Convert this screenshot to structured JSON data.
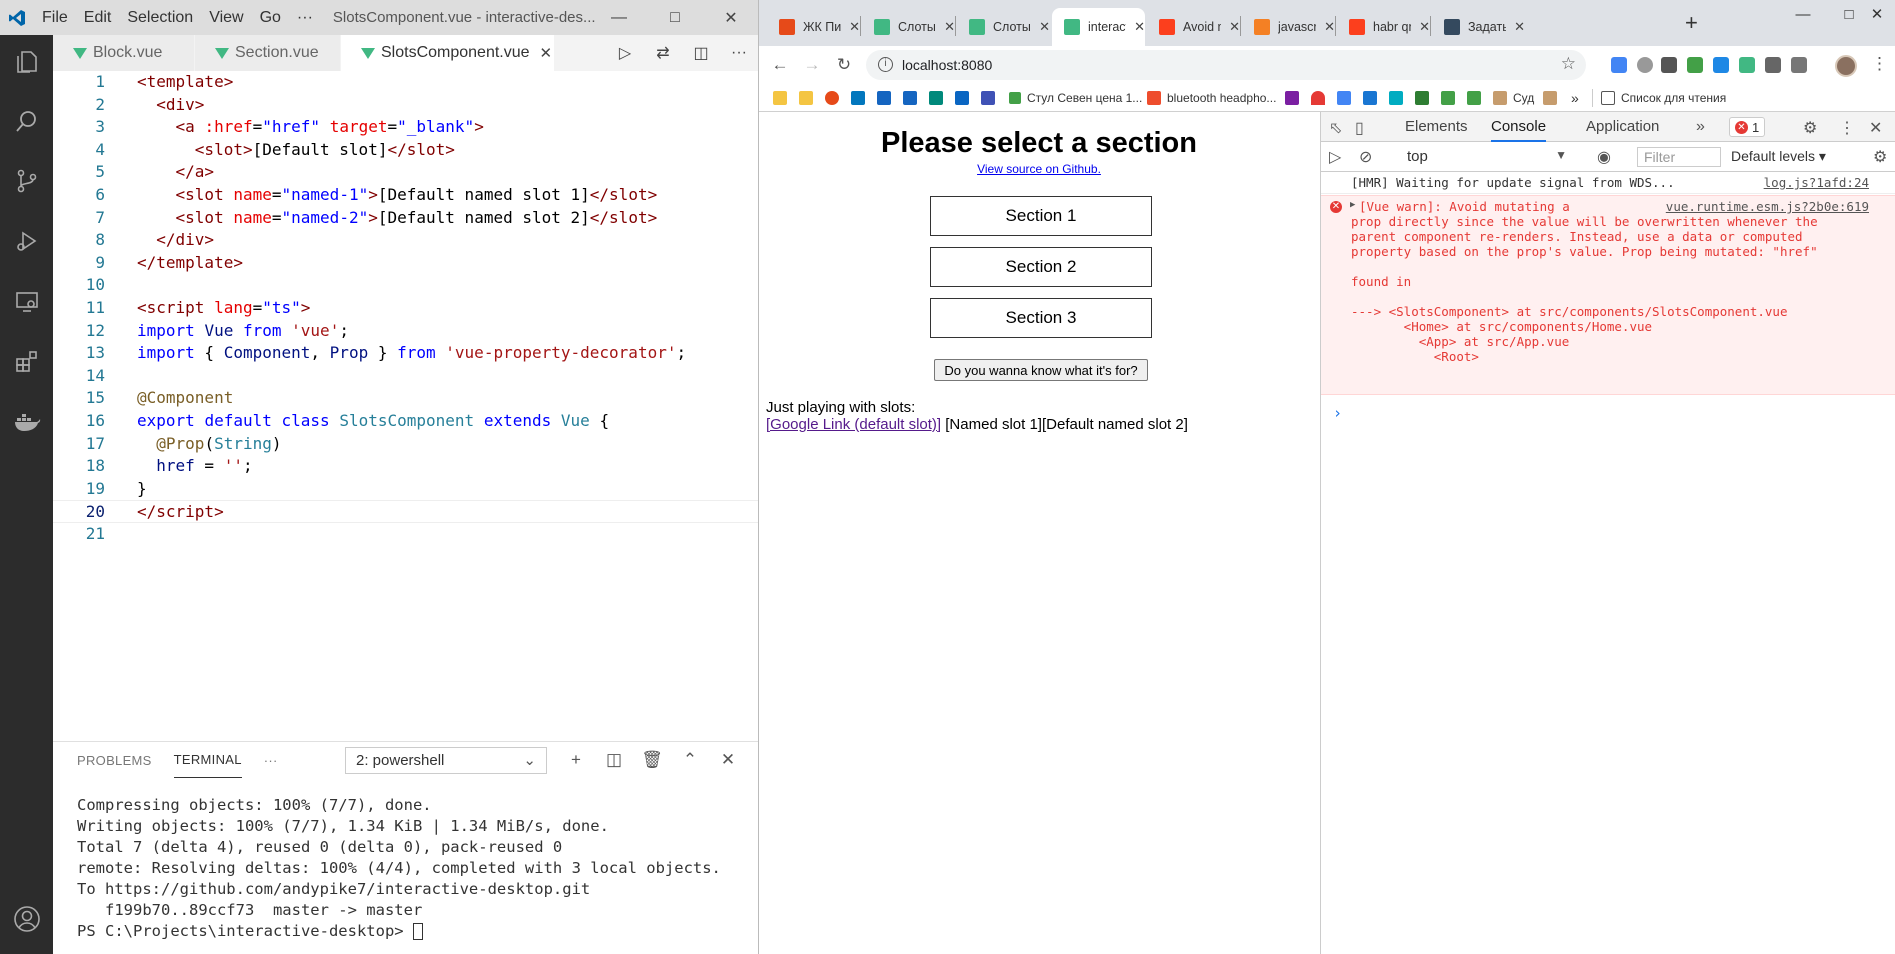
{
  "vscode": {
    "menu": [
      "File",
      "Edit",
      "Selection",
      "View",
      "Go",
      "···"
    ],
    "window_title": "SlotsComponent.vue - interactive-des...",
    "tabs": [
      {
        "label": "Block.vue"
      },
      {
        "label": "Section.vue"
      },
      {
        "label": "SlotsComponent.vue"
      }
    ],
    "code": [
      {
        "n": "1",
        "html": "<span class='t-tag'>&lt;template&gt;</span>"
      },
      {
        "n": "2",
        "html": "  <span class='t-tag'>&lt;div&gt;</span>"
      },
      {
        "n": "3",
        "html": "    <span class='t-tag'>&lt;a</span> <span class='t-attr'>:href</span>=<span class='t-str'>\"href\"</span> <span class='t-attr'>target</span>=<span class='t-str'>\"_blank\"</span><span class='t-tag'>&gt;</span>"
      },
      {
        "n": "4",
        "html": "      <span class='t-tag'>&lt;slot&gt;</span>[Default slot]<span class='t-tag'>&lt;/slot&gt;</span>"
      },
      {
        "n": "5",
        "html": "    <span class='t-tag'>&lt;/a&gt;</span>"
      },
      {
        "n": "6",
        "html": "    <span class='t-tag'>&lt;slot</span> <span class='t-attr'>name</span>=<span class='t-str'>\"named-1\"</span><span class='t-tag'>&gt;</span>[Default named slot 1]<span class='t-tag'>&lt;/slot&gt;</span>"
      },
      {
        "n": "7",
        "html": "    <span class='t-tag'>&lt;slot</span> <span class='t-attr'>name</span>=<span class='t-str'>\"named-2\"</span><span class='t-tag'>&gt;</span>[Default named slot 2]<span class='t-tag'>&lt;/slot&gt;</span>"
      },
      {
        "n": "8",
        "html": "  <span class='t-tag'>&lt;/div&gt;</span>"
      },
      {
        "n": "9",
        "html": "<span class='t-tag'>&lt;/template&gt;</span>"
      },
      {
        "n": "10",
        "html": ""
      },
      {
        "n": "11",
        "html": "<span class='t-tag'>&lt;script</span> <span class='t-attr'>lang</span>=<span class='t-str'>\"ts\"</span><span class='t-tag'>&gt;</span>"
      },
      {
        "n": "12",
        "html": "<span class='t-kw'>import</span> <span class='t-var'>Vue</span> <span class='t-kw'>from</span> <span class='t-str2'>'vue'</span>;"
      },
      {
        "n": "13",
        "html": "<span class='t-kw'>import</span> { <span class='t-var'>Component</span>, <span class='t-var'>Prop</span> } <span class='t-kw'>from</span> <span class='t-str2'>'vue-property-decorator'</span>;"
      },
      {
        "n": "14",
        "html": ""
      },
      {
        "n": "15",
        "html": "<span class='t-fn'>@Component</span>"
      },
      {
        "n": "16",
        "html": "<span class='t-kw'>export</span> <span class='t-kw'>default</span> <span class='t-kw'>class</span> <span class='t-cls'>SlotsComponent</span> <span class='t-kw'>extends</span> <span class='t-cls'>Vue</span> {"
      },
      {
        "n": "17",
        "html": "  <span class='t-fn'>@Prop</span>(<span class='t-cls'>String</span>)"
      },
      {
        "n": "18",
        "html": "  <span class='t-var'>href</span> = <span class='t-str2'>''</span>;"
      },
      {
        "n": "19",
        "html": "}"
      },
      {
        "n": "20",
        "html": "<span class='t-tag'>&lt;/script&gt;</span>"
      },
      {
        "n": "21",
        "html": ""
      }
    ],
    "panel": {
      "tabs": [
        "PROBLEMS",
        "TERMINAL",
        "···"
      ],
      "terminal_select": "2: powershell",
      "lines": [
        "Compressing objects: 100% (7/7), done.",
        "Writing objects: 100% (7/7), 1.34 KiB | 1.34 MiB/s, done.",
        "Total 7 (delta 4), reused 0 (delta 0), pack-reused 0",
        "remote: Resolving deltas: 100% (4/4), completed with 3 local objects.",
        "To https://github.com/andypike7/interactive-desktop.git",
        "   f199b70..89ccf73  master -> master",
        "PS C:\\Projects\\interactive-desktop> "
      ]
    }
  },
  "chrome": {
    "tabs": [
      {
        "label": "ЖК Пиро",
        "color": "#e64a19"
      },
      {
        "label": "Слоты —",
        "color": "#41b883"
      },
      {
        "label": "Слоты —",
        "color": "#41b883"
      },
      {
        "label": "interactiv",
        "color": "#41b883"
      },
      {
        "label": "Avoid mu",
        "color": "#fc3f1d"
      },
      {
        "label": "javascript",
        "color": "#f48024"
      },
      {
        "label": "habr qna",
        "color": "#fc3f1d"
      },
      {
        "label": "Задать в",
        "color": "#34495e"
      }
    ],
    "url": "localhost:8080",
    "bookmarks": {
      "b1": "Стул Севен цена 1...",
      "b2": "bluetooth headpho...",
      "b3": "Суд",
      "b4": "Список для чтения"
    }
  },
  "page": {
    "title": "Please select a section",
    "github_link": "View source on Github.",
    "sections": [
      "Section 1",
      "Section 2",
      "Section 3"
    ],
    "what_button": "Do you wanna know what it's for?",
    "slots_title": "Just playing with slots:",
    "slot_link": "[Google Link (default slot)]",
    "slot_rest": " [Named slot 1][Default named slot 2]"
  },
  "devtools": {
    "tabs": [
      "Elements",
      "Console",
      "Application"
    ],
    "error_count": "1",
    "context": "top",
    "filter_placeholder": "Filter",
    "levels": "Default levels",
    "info_msg": "[HMR] Waiting for update signal from WDS...",
    "info_src": "log.js?1afd:24",
    "err_src": "vue.runtime.esm.js?2b0e:619",
    "err_lines": [
      "[Vue warn]: Avoid mutating a",
      "prop directly since the value will be overwritten whenever the",
      "parent component re-renders. Instead, use a data or computed",
      "property based on the prop's value. Prop being mutated: \"href\"",
      "",
      "found in",
      "",
      "---> <SlotsComponent> at src/components/SlotsComponent.vue",
      "       <Home> at src/components/Home.vue",
      "         <App> at src/App.vue",
      "           <Root>"
    ]
  }
}
